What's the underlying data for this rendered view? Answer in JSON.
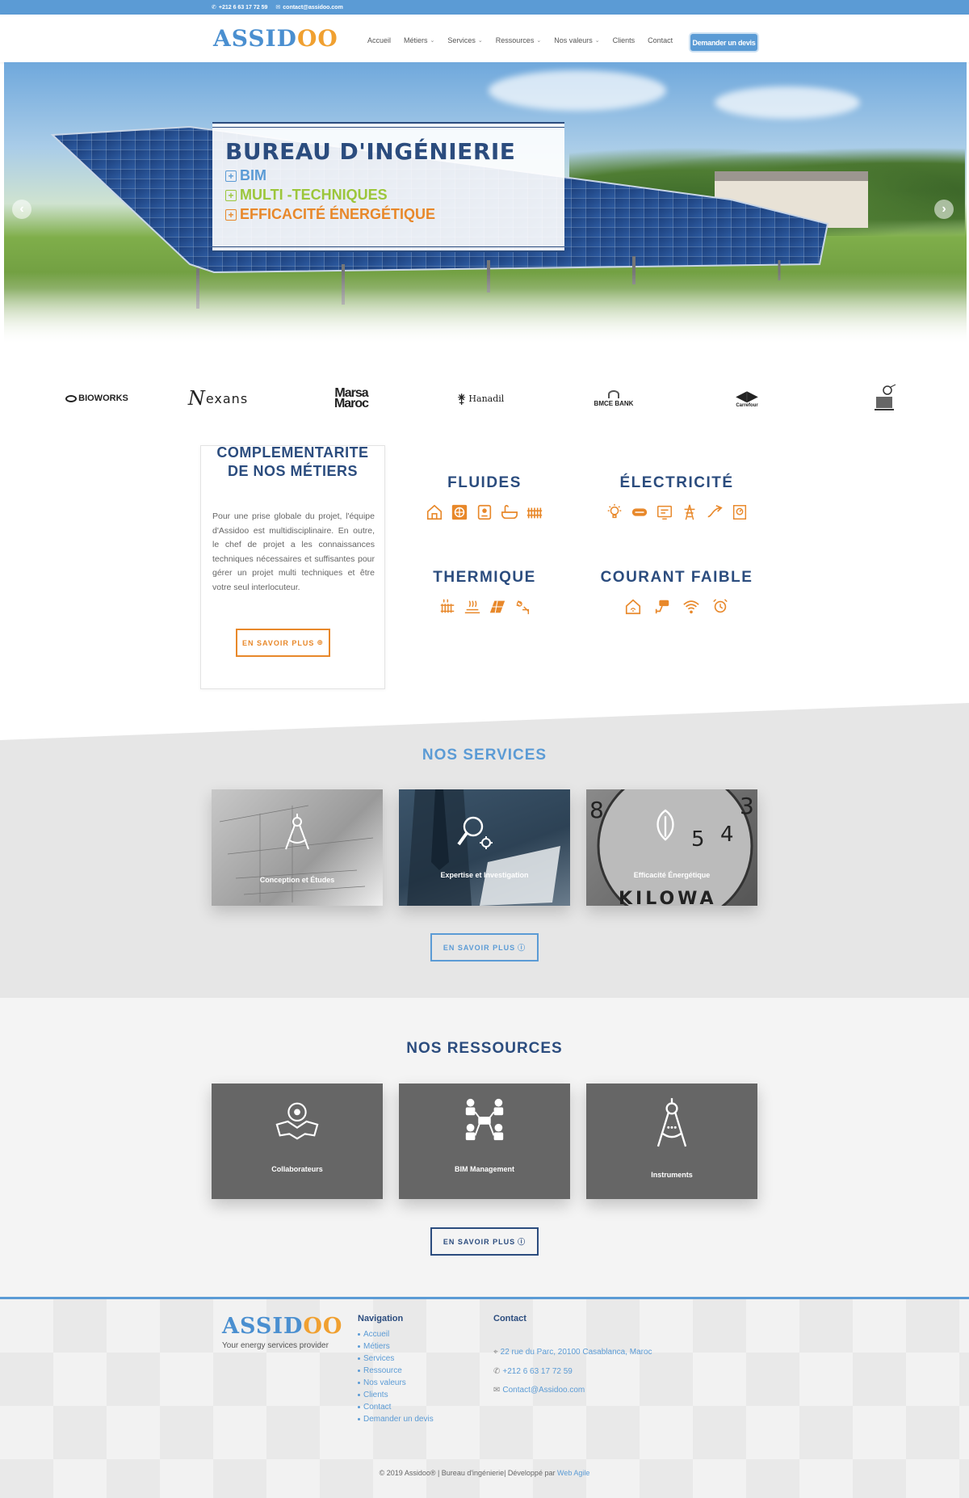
{
  "topbar": {
    "phone": "+212 6 63 17 72 59",
    "email": "contact@assidoo.com"
  },
  "header": {
    "logo": {
      "main": "ASSID",
      "accent": "OO"
    },
    "nav": [
      {
        "label": "Accueil",
        "dropdown": false,
        "active": true
      },
      {
        "label": "Métiers",
        "dropdown": true,
        "active": false
      },
      {
        "label": "Services",
        "dropdown": true,
        "active": false
      },
      {
        "label": "Ressources",
        "dropdown": true,
        "active": false
      },
      {
        "label": "Nos valeurs",
        "dropdown": true,
        "active": false
      },
      {
        "label": "Clients",
        "dropdown": false,
        "active": false
      },
      {
        "label": "Contact",
        "dropdown": false,
        "active": false
      }
    ],
    "cta": "Demander un devis"
  },
  "hero": {
    "title": "BUREAU D'INGÉNIERIE",
    "lines": [
      {
        "label": "BIM",
        "color": "#5b9bd5"
      },
      {
        "label": "MULTI -TECHNIQUES",
        "color": "#9cc63b"
      },
      {
        "label": "EFFICACITÉ ÉNERGÉTIQUE",
        "color": "#e8882a"
      }
    ],
    "prev": "‹",
    "next": "›"
  },
  "clients": [
    "BIOWORKS",
    "exans",
    "Marsa",
    "Maroc",
    "Hanadil",
    "BMCE BANK",
    "Carrefour"
  ],
  "metiers_card": {
    "title_top": "COMPLÉMENTARITÉ",
    "title_bottom": "DE NOS MÉTIERS",
    "text": "Pour une prise globale du projet, l'équipe d'Assidoo est multidisciplinaire. En outre, le chef de projet a les connaissances techniques nécessaires et suffisantes pour gérer un projet multi techniques et être votre seul interlocuteur.",
    "button": "EN SAVOIR PLUS"
  },
  "metiers": [
    {
      "name": "FLUIDES",
      "icons": [
        "house-icon",
        "fan-icon",
        "boiler-icon",
        "bathtub-icon",
        "radiator-icon"
      ]
    },
    {
      "name": "ÉLECTRICITÉ",
      "icons": [
        "bulb-icon",
        "cable-icon",
        "panel-icon",
        "pylon-icon",
        "switch-icon",
        "meter-icon"
      ]
    },
    {
      "name": "THERMIQUE",
      "icons": [
        "heater-icon",
        "floor-heating-icon",
        "solar-panel-icon",
        "snow-icon"
      ]
    },
    {
      "name": "COURANT FAIBLE",
      "icons": [
        "smart-home-icon",
        "camera-icon",
        "wifi-icon",
        "alarm-icon"
      ]
    }
  ],
  "services": {
    "title": "NOS SERVICES",
    "items": [
      {
        "label": "Conception et Études",
        "icon": "compass-icon"
      },
      {
        "label": "Expertise et Investigation",
        "icon": "magnifier-gear-icon"
      },
      {
        "label": "Efficacité Énergétique",
        "icon": "leaf-icon",
        "clock_digits": [
          "8",
          "3",
          "5",
          "4"
        ],
        "clock_text": "KILOWA"
      }
    ],
    "button": "EN SAVOIR PLUS"
  },
  "ressources": {
    "title": "NOS RESSOURCES",
    "items": [
      {
        "label": "Collaborateurs",
        "icon": "handshake-gear-icon"
      },
      {
        "label": "BIM Management",
        "icon": "team-network-icon"
      },
      {
        "label": "Instruments",
        "icon": "compass-icon"
      }
    ],
    "button": "EN SAVOIR PLUS"
  },
  "footer": {
    "logo": {
      "main": "ASSID",
      "accent": "OO"
    },
    "tagline": "Your energy services provider",
    "nav_title": "Navigation",
    "nav_links": [
      "Accueil",
      "Métiers",
      "Services",
      "Ressource",
      "Nos valeurs",
      "Clients",
      "Contact",
      "Demander un devis"
    ],
    "contact_title": "Contact",
    "address": "22 rue du Parc, 20100 Casablanca, Maroc",
    "phone": "+212 6 63 17 72 59",
    "email": "Contact@Assidoo.com",
    "copyright_prefix": "© 2019 Assidoo® | Bureau d'ingénierie| Développé par",
    "copyright_link": "Web Agile"
  },
  "colors": {
    "brand_blue": "#5b9bd5",
    "navy": "#2b4c7e",
    "orange": "#e8882a",
    "green": "#9cc63b"
  }
}
